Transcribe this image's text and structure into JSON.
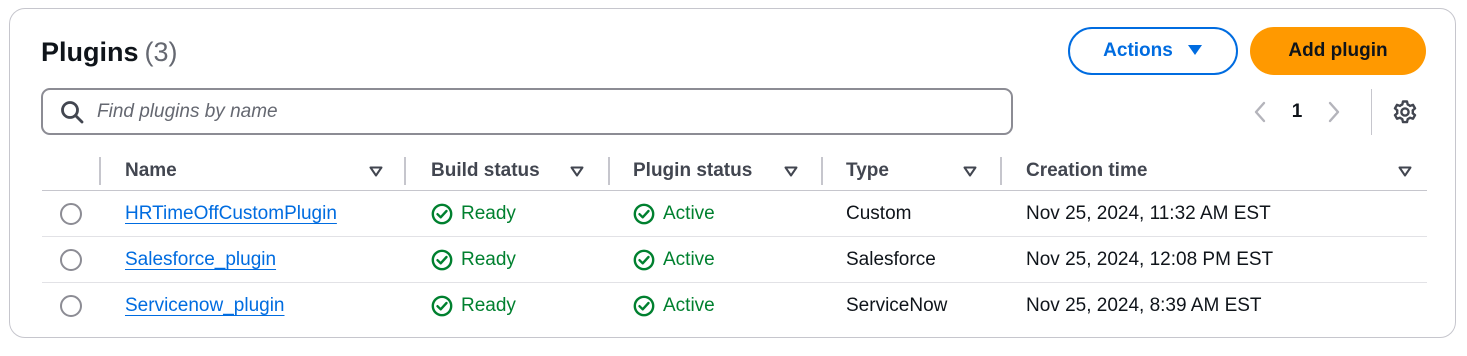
{
  "header": {
    "title": "Plugins",
    "count": "(3)"
  },
  "buttons": {
    "actions_label": "Actions",
    "add_label": "Add plugin"
  },
  "search": {
    "placeholder": "Find plugins by name"
  },
  "pagination": {
    "current_page": "1"
  },
  "icons": {
    "search": "search-icon",
    "actions_dropdown": "caret-down-icon",
    "prev": "chevron-left-icon",
    "next": "chevron-right-icon",
    "settings": "gear-icon",
    "sort": "sort-caret-down-icon",
    "status": "check-circle-icon"
  },
  "colors": {
    "link": "#006ce0",
    "primary_button": "#ff9900",
    "success": "#00802f",
    "border": "#c6c6cd"
  },
  "table": {
    "columns": [
      "Name",
      "Build status",
      "Plugin status",
      "Type",
      "Creation time"
    ],
    "rows": [
      {
        "name": "HRTimeOffCustomPlugin",
        "build_status": "Ready",
        "plugin_status": "Active",
        "type": "Custom",
        "created": "Nov 25, 2024, 11:32 AM EST"
      },
      {
        "name": "Salesforce_plugin",
        "build_status": "Ready",
        "plugin_status": "Active",
        "type": "Salesforce",
        "created": "Nov 25, 2024, 12:08 PM EST"
      },
      {
        "name": "Servicenow_plugin",
        "build_status": "Ready",
        "plugin_status": "Active",
        "type": "ServiceNow",
        "created": "Nov 25, 2024, 8:39 AM EST"
      }
    ]
  }
}
